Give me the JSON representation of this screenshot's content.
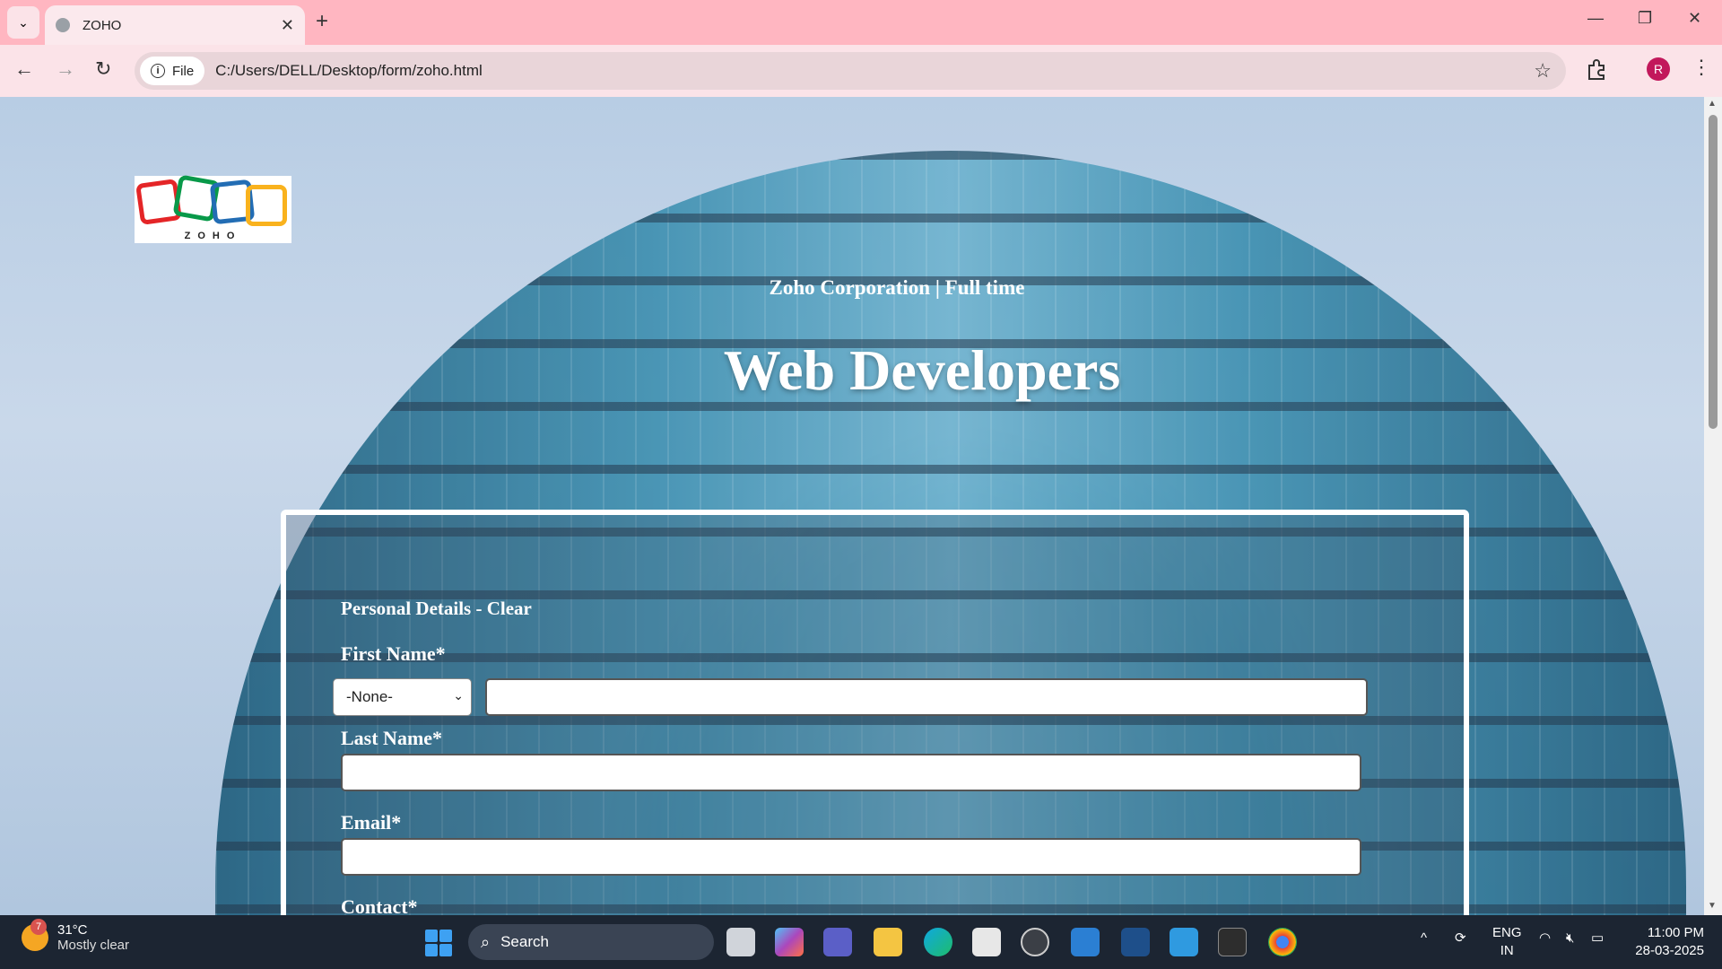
{
  "browser": {
    "tab_title": "ZOHO",
    "file_chip": "File",
    "url": "C:/Users/DELL/Desktop/form/zoho.html",
    "profile_initial": "R"
  },
  "page": {
    "logo_text": "ZOHO",
    "subtitle": "Zoho Corporation | Full time",
    "headline": "Web Developers",
    "form": {
      "section_title": "Personal Details - Clear",
      "first_name_label": "First Name*",
      "salutation_selected": "-None-",
      "last_name_label": "Last Name*",
      "email_label": "Email*",
      "contact_label": "Contact*"
    }
  },
  "taskbar": {
    "weather_temp": "31°C",
    "weather_desc": "Mostly clear",
    "weather_badge": "7",
    "search_label": "Search",
    "lang_top": "ENG",
    "lang_bottom": "IN",
    "time": "11:00 PM",
    "date": "28-03-2025"
  },
  "colors": {
    "chrome_pink": "#ffb6c1",
    "taskbar": "#1c2532",
    "logo_red": "#e42527",
    "logo_green": "#089949",
    "logo_blue": "#226db4",
    "logo_yellow": "#f9b21d"
  }
}
